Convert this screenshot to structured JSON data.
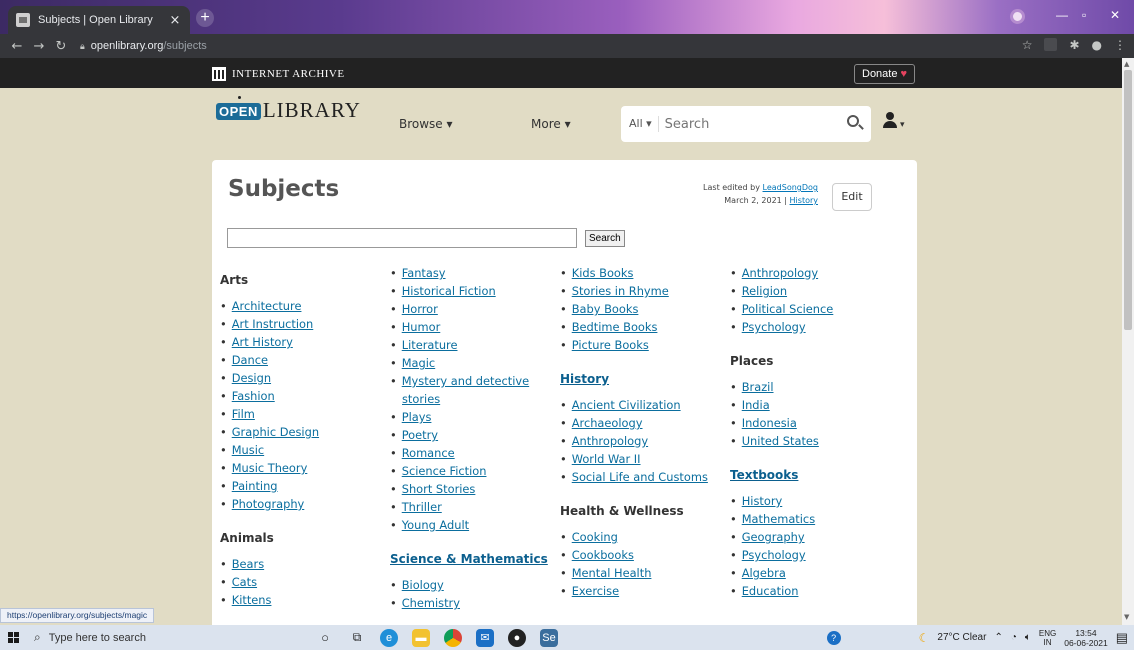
{
  "browser": {
    "tab_title": "Subjects | Open Library",
    "tab_close": "×",
    "new_tab": "+",
    "url_host": "openlibrary.org",
    "url_path": "/subjects",
    "status_url": "https://openlibrary.org/subjects/magic"
  },
  "ia_bar": {
    "brand": "INTERNET ARCHIVE",
    "donate_label": "Donate",
    "donate_heart": "♥"
  },
  "header": {
    "logo_open": "OPEN",
    "logo_library": "LIBRARY",
    "browse_label": "Browse ▾",
    "more_label": "More ▾",
    "search_scope": "All ▾",
    "search_placeholder": "Search"
  },
  "page": {
    "title": "Subjects",
    "edited_prefix": "Last edited by ",
    "edited_by": "LeadSongDog",
    "edited_date": "March 2, 2021",
    "edited_sep": " | ",
    "history_link": "History",
    "edit_button": "Edit",
    "search_button": "Search"
  },
  "columns": [
    {
      "sections": [
        {
          "heading": "Arts",
          "heading_link": false,
          "items": [
            "Architecture",
            "Art Instruction",
            "Art History",
            "Dance",
            "Design",
            "Fashion",
            "Film",
            "Graphic Design",
            "Music",
            "Music Theory",
            "Painting",
            "Photography"
          ]
        },
        {
          "heading": "Animals",
          "heading_link": false,
          "items": [
            "Bears",
            "Cats",
            "Kittens"
          ]
        }
      ]
    },
    {
      "sections": [
        {
          "heading": "",
          "heading_link": false,
          "items": [
            "Fantasy",
            "Historical Fiction",
            "Horror",
            "Humor",
            "Literature",
            "Magic",
            "Mystery and detective",
            "stories",
            "Plays",
            "Poetry",
            "Romance",
            "Science Fiction",
            "Short Stories",
            "Thriller",
            "Young Adult"
          ]
        },
        {
          "heading": "Science & Mathematics",
          "heading_link": true,
          "items": [
            "Biology",
            "Chemistry"
          ]
        }
      ]
    },
    {
      "sections": [
        {
          "heading": "",
          "heading_link": false,
          "items": [
            "Kids Books",
            "Stories in Rhyme",
            "Baby Books",
            "Bedtime Books",
            "Picture Books"
          ]
        },
        {
          "heading": "History",
          "heading_link": true,
          "items": [
            "Ancient Civilization",
            "Archaeology",
            "Anthropology",
            "World War II",
            "Social Life and Customs"
          ]
        },
        {
          "heading": "Health & Wellness",
          "heading_link": false,
          "items": [
            "Cooking",
            "Cookbooks",
            "Mental Health",
            "Exercise"
          ]
        }
      ]
    },
    {
      "sections": [
        {
          "heading": "",
          "heading_link": false,
          "items": [
            "Anthropology",
            "Religion",
            "Political Science",
            "Psychology"
          ]
        },
        {
          "heading": "Places",
          "heading_link": false,
          "items": [
            "Brazil",
            "India",
            "Indonesia",
            "United States"
          ]
        },
        {
          "heading": "Textbooks",
          "heading_link": true,
          "items": [
            "History",
            "Mathematics",
            "Geography",
            "Psychology",
            "Algebra",
            "Education"
          ]
        }
      ]
    }
  ],
  "taskbar": {
    "search_placeholder": "Type here to search",
    "weather": "27°C Clear",
    "lang_top": "ENG",
    "lang_bottom": "IN",
    "time": "13:54",
    "date": "06-06-2021"
  }
}
